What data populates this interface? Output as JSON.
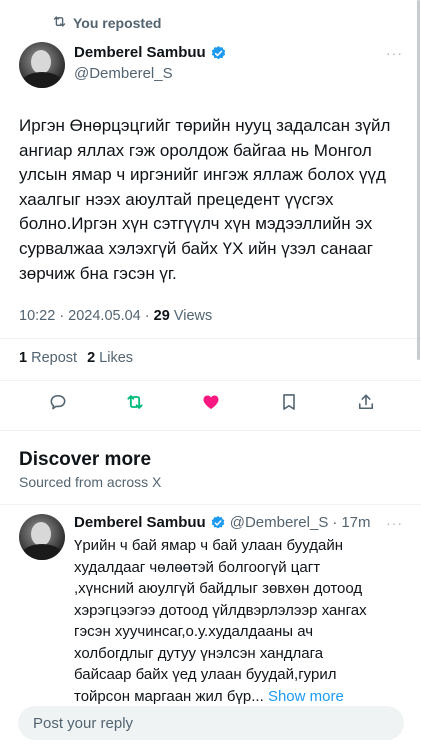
{
  "repost_banner": {
    "label": "You reposted",
    "icon": "repost-icon"
  },
  "tweet": {
    "author_name": "Demberel Sambuu",
    "author_handle": "@Demberel_S",
    "verified_icon": "verified-badge-icon",
    "text": "Иргэн Өнөрцэцгийг төрийн нууц задалсан зүйл ангиар яллах гэж оролдож байгаа нь Монгол улсын ямар ч иргэнийг ингэж яллаж болох үүд хаалгыг нээх аюултай прецедент үүсгэх болно.Иргэн хүн сэтгүүлч хүн мэдээллийн эх сурвалжаа хэлэхгүй байх ҮХ ийн үзэл санааг зөрчиж бна гэсэн үг.",
    "time": "10:22 · 2024.05.04 · ",
    "views_count": "29",
    "views_label": "Views",
    "repost_count": "1",
    "repost_label": "Repost",
    "likes_count": "2",
    "likes_label": "Likes",
    "more_label": "···"
  },
  "actions": {
    "reply_icon": "reply-icon",
    "repost_icon": "repost-icon",
    "like_icon": "heart-filled-icon",
    "bookmark_icon": "bookmark-icon",
    "share_icon": "share-icon"
  },
  "discover": {
    "title": "Discover more",
    "subtitle": "Sourced from across X",
    "recommended": {
      "author_name": "Demberel Sambuu",
      "author_handle": "@Demberel_S",
      "time": "17m",
      "separator": "·",
      "more_label": "···",
      "text": "Үрийн ч бай ямар ч бай улаан буудайн худалдааг чөлөөтэй болгоогүй цагт ,хүнсний аюулгүй байдлыг зөвхөн дотоод хэрэгцээгээ дотоод үйлдвэрлэлээр хангах гэсэн хуучинсаг,о.у.худалдааны ач холбогдлыг дутуу үнэлсэн хандлага байсаар байх үед улаан буудай,гурил тойрсон маргаан жил бүр...",
      "show_more": "Show more"
    }
  },
  "reply_bar": {
    "placeholder": "Post your reply"
  },
  "colors": {
    "accent": "#1d9bf0",
    "repost_green": "#00ba7c",
    "like_pink": "#f91880",
    "muted_text": "#536471"
  }
}
